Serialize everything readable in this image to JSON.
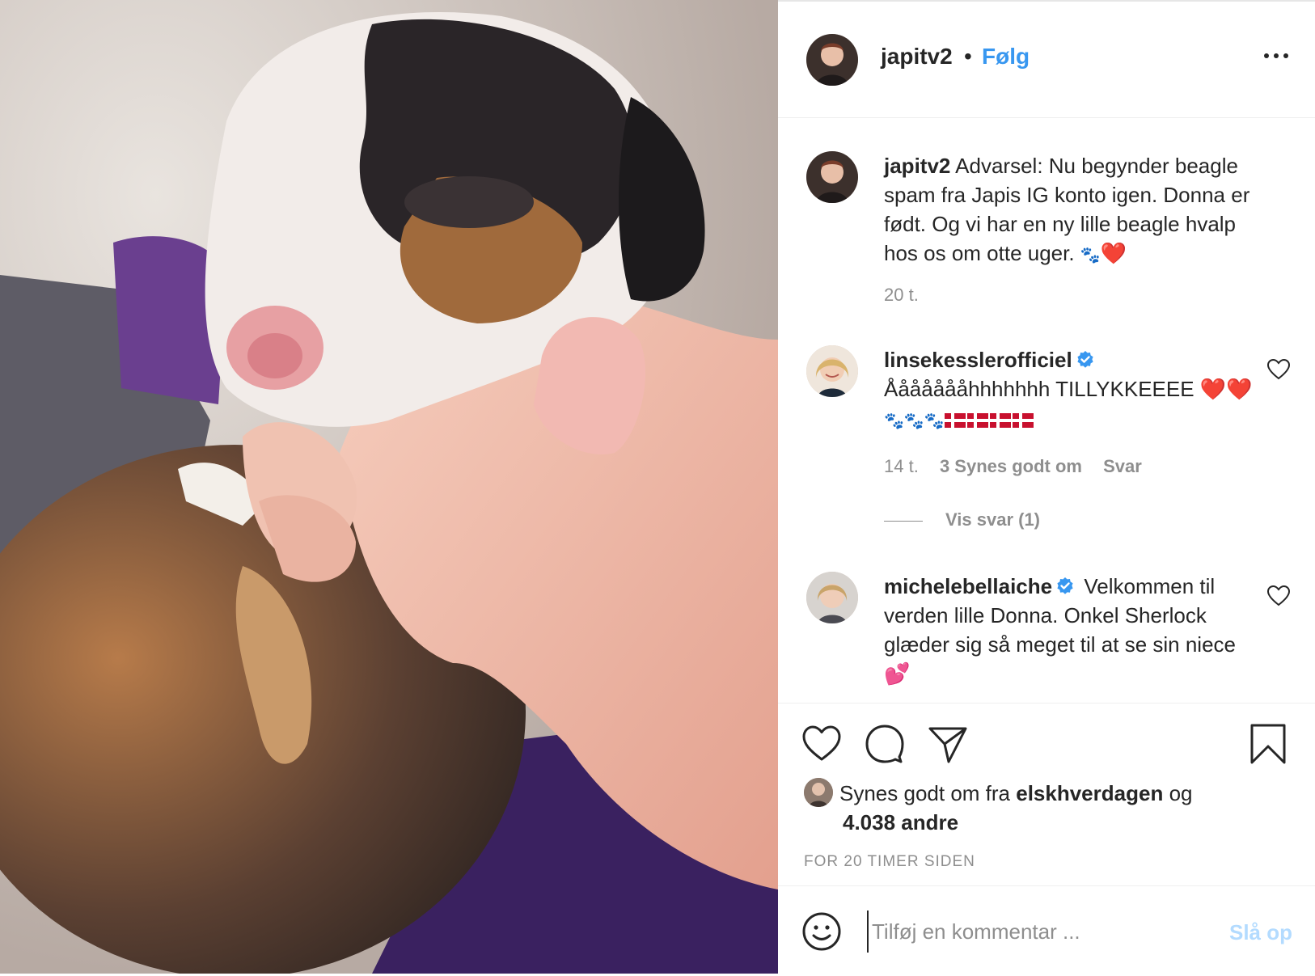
{
  "colors": {
    "accent": "#3897f0",
    "post_disabled": "#b3dbff",
    "muted": "#8e8e8e",
    "text": "#262626",
    "heart": "#e0245e"
  },
  "header": {
    "username": "japitv2",
    "separator": "•",
    "follow_label": "Følg",
    "more_icon": "ellipsis-icon"
  },
  "caption": {
    "username": "japitv2",
    "text": "Advarsel: Nu begynder beagle spam fra Japis IG konto igen. Donna er født. Og vi har en ny lille beagle hvalp hos os om otte uger.",
    "emoji": "🐾",
    "heart": "❤️",
    "age": "20 t."
  },
  "comments": [
    {
      "username": "linsekesslerofficiel",
      "verified": true,
      "text": "Åååååååhhhhhhh TILLYKKEEEE",
      "hearts": "❤️❤️",
      "paws": "🐾🐾🐾",
      "age": "14 t.",
      "likes": "3 Synes godt om",
      "reply": "Svar",
      "view_replies": "Vis svar (1)"
    },
    {
      "username": "michelebellaiche",
      "verified": true,
      "text": "Velkommen til verden lille Donna. Onkel Sherlock glæder sig så meget til at se sin niece",
      "emoji": "💕"
    }
  ],
  "actions": {
    "like_icon": "heart-icon",
    "comment_icon": "comment-icon",
    "share_icon": "share-icon",
    "save_icon": "bookmark-icon"
  },
  "likes": {
    "prefix": "Synes godt om fra",
    "liker": "elskhverdagen",
    "connector": "og",
    "others": "4.038 andre"
  },
  "timestamp": "FOR 20 TIMER SIDEN",
  "add_comment": {
    "placeholder": "Tilføj en kommentar ...",
    "post_label": "Slå op"
  }
}
